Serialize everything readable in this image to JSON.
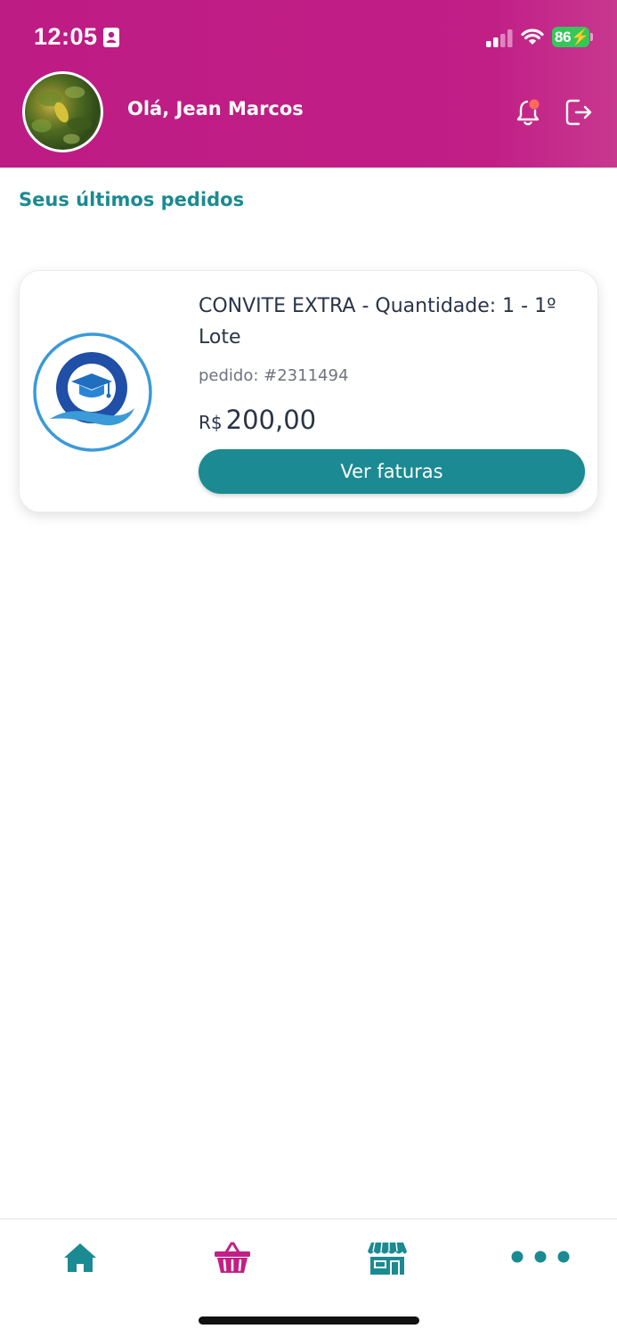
{
  "status_bar": {
    "time": "12:05",
    "battery": "86",
    "icons": [
      "id-card-icon",
      "signal-icon",
      "wifi-icon",
      "battery-charging-icon"
    ]
  },
  "header": {
    "greeting": "Olá, Jean Marcos",
    "background_color": "#bd1c84",
    "icons": [
      "avatar",
      "bell-icon",
      "logout-icon"
    ],
    "notification_dot_color": "#ff6a5c"
  },
  "orders": {
    "section_title": "Seus últimos pedidos",
    "accent_color": "#1b8a92",
    "items": [
      {
        "title": "CONVITE EXTRA - Quantidade: 1 - 1º Lote",
        "order_number": "pedido: #2311494",
        "currency": "R$",
        "amount": "200,00",
        "button_label": "Ver faturas",
        "logo_icon": "graduation-cap-q-logo"
      }
    ]
  },
  "bottom_nav": {
    "items": [
      {
        "icon": "home-icon",
        "color": "#1b8a92"
      },
      {
        "icon": "basket-icon",
        "color": "#c11f86"
      },
      {
        "icon": "store-icon",
        "color": "#1b8a92"
      },
      {
        "icon": "more-icon",
        "color": "#1b8a92"
      }
    ]
  }
}
